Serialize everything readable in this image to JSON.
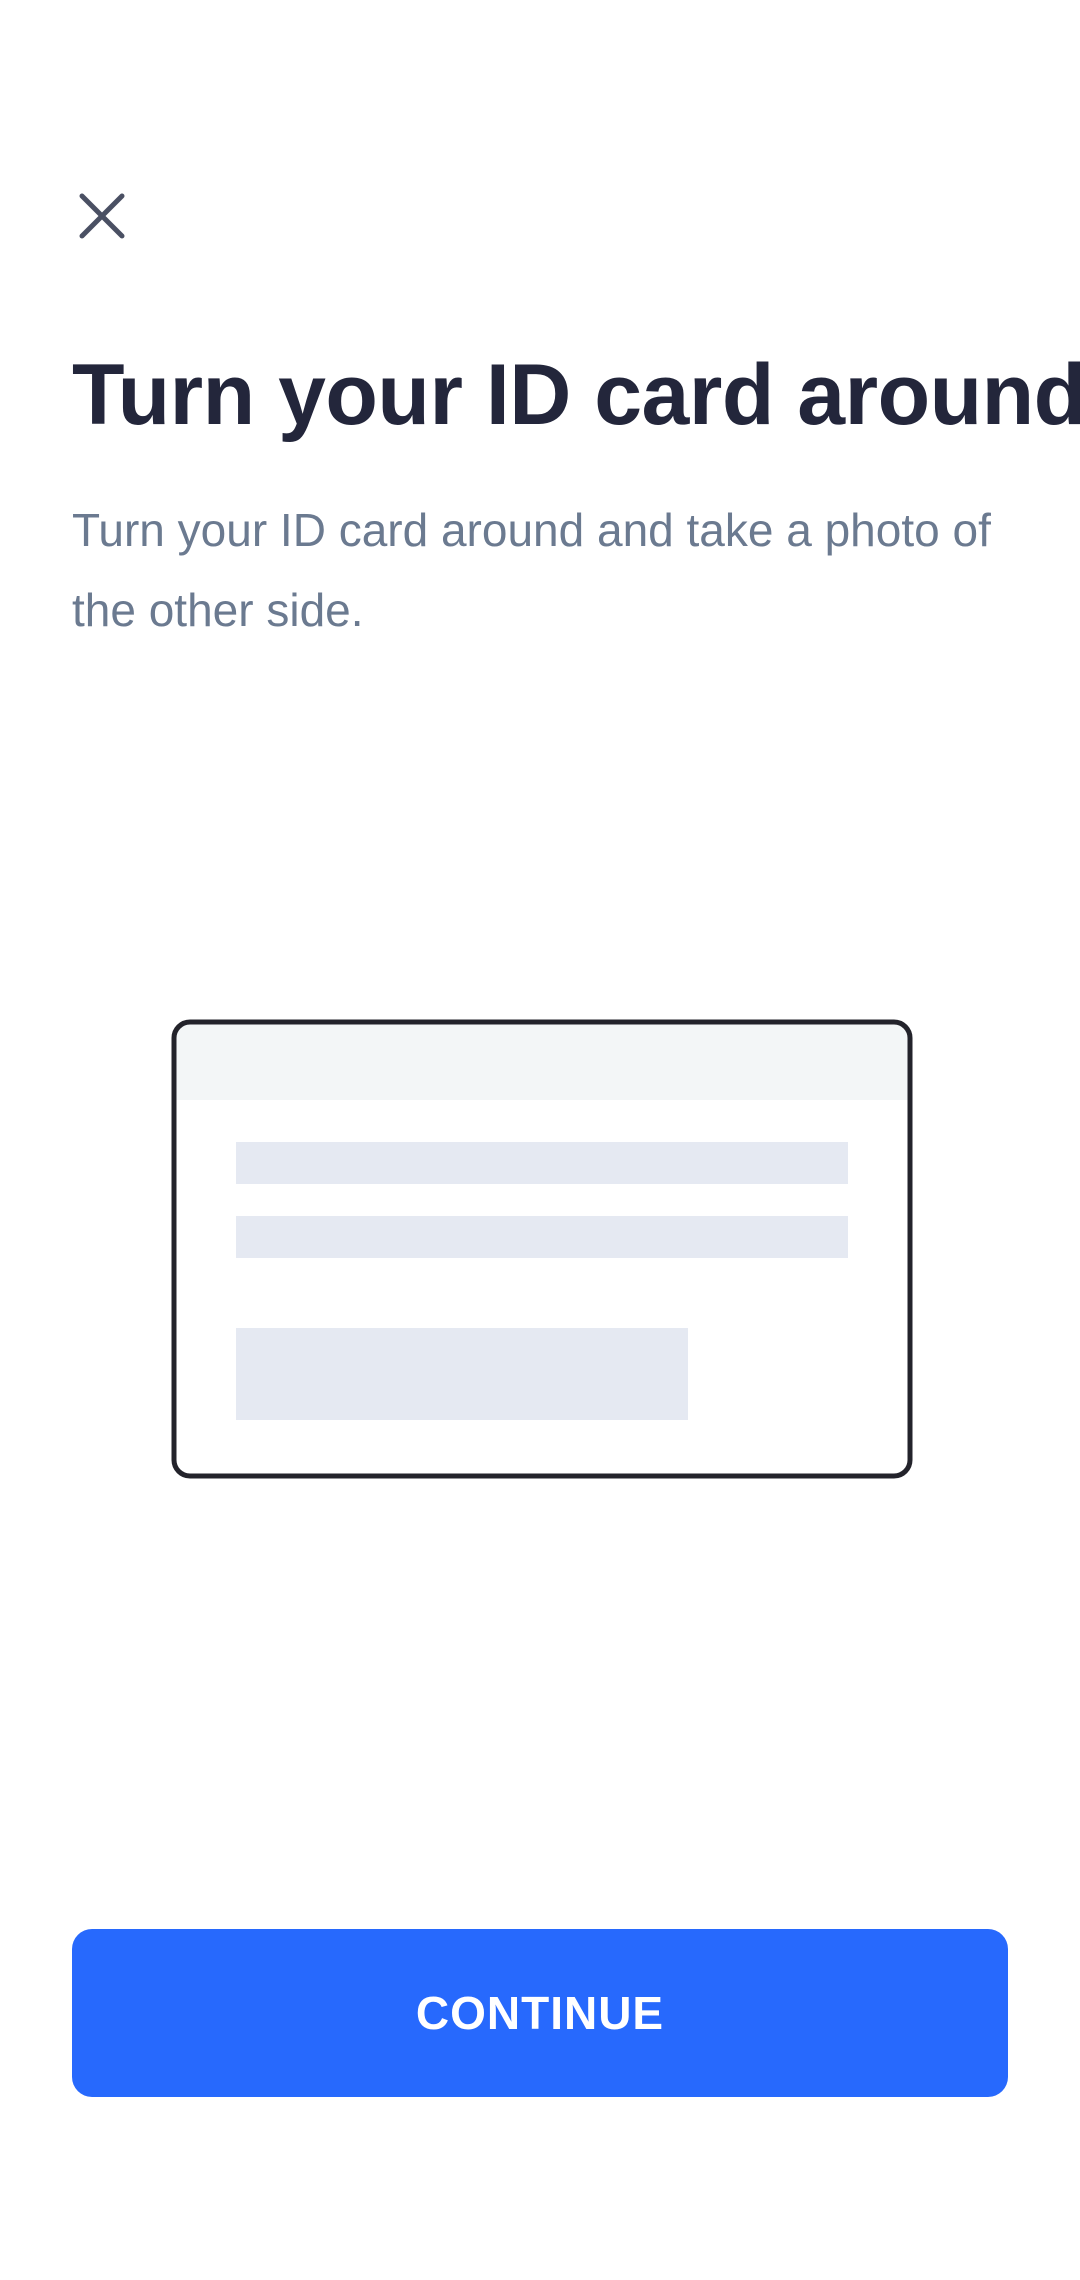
{
  "screen": {
    "title": "Turn your ID card around",
    "subtitle": "Turn your ID card around and take a photo of the other side."
  },
  "close": {
    "icon": "close-icon"
  },
  "illustration": {
    "icon": "id-card-back-illustration",
    "colors": {
      "outline": "#23232b",
      "header_band": "#f3f6f7",
      "placeholder_lines": "#e5e9f2"
    }
  },
  "actions": {
    "continue_label": "CONTINUE"
  },
  "colors": {
    "primary": "#2769fd",
    "title": "#23263b",
    "subtitle": "#6b7a90",
    "background": "#ffffff"
  }
}
